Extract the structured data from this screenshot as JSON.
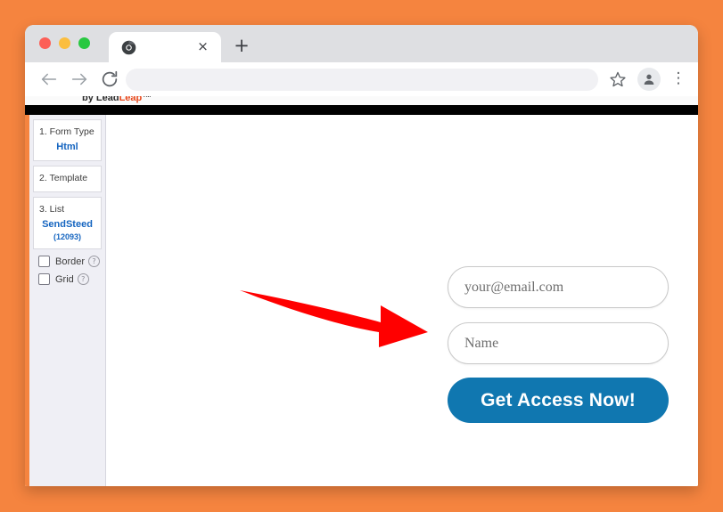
{
  "window": {
    "traffic_lights": [
      "close",
      "minimize",
      "maximize"
    ],
    "tab": {
      "favicon": "chrome-favicon",
      "close_label": "×"
    },
    "new_tab_label": "+"
  },
  "toolbar": {
    "back_icon": "arrow-left-icon",
    "forward_icon": "arrow-right-icon",
    "reload_icon": "reload-icon",
    "address_value": "",
    "address_placeholder": "",
    "bookmark_icon": "star-icon",
    "profile_icon": "account-avatar-icon",
    "menu_label": "⋮"
  },
  "page": {
    "brand_prefix": "by Lead",
    "brand_suffix": "Leap",
    "brand_mark": "™"
  },
  "sidebar": {
    "steps": [
      {
        "label": "1. Form Type",
        "value": "Html",
        "count": null
      },
      {
        "label": "2. Template",
        "value": null,
        "count": null
      },
      {
        "label": "3. List",
        "value": "SendSteed",
        "count": "(12093)"
      }
    ],
    "options": [
      {
        "label": "Border",
        "checked": false,
        "help": "?"
      },
      {
        "label": "Grid",
        "checked": false,
        "help": "?"
      }
    ]
  },
  "form": {
    "email_value": "your@email.com",
    "email_placeholder": "your@email.com",
    "name_value": "Name",
    "name_placeholder": "Name",
    "submit_label": "Get Access Now!"
  },
  "annotation": {
    "arrow_name": "red-pointer-arrow",
    "arrow_color": "#FF0000",
    "points_to": "name-field"
  },
  "colors": {
    "desktop_background": "#F5843F",
    "accent_orange": "#F5843F",
    "brand_accent": "#E8491D",
    "link_blue": "#1565C0",
    "button_blue": "#1077B0",
    "sidebar_background": "#EFEFF5"
  }
}
